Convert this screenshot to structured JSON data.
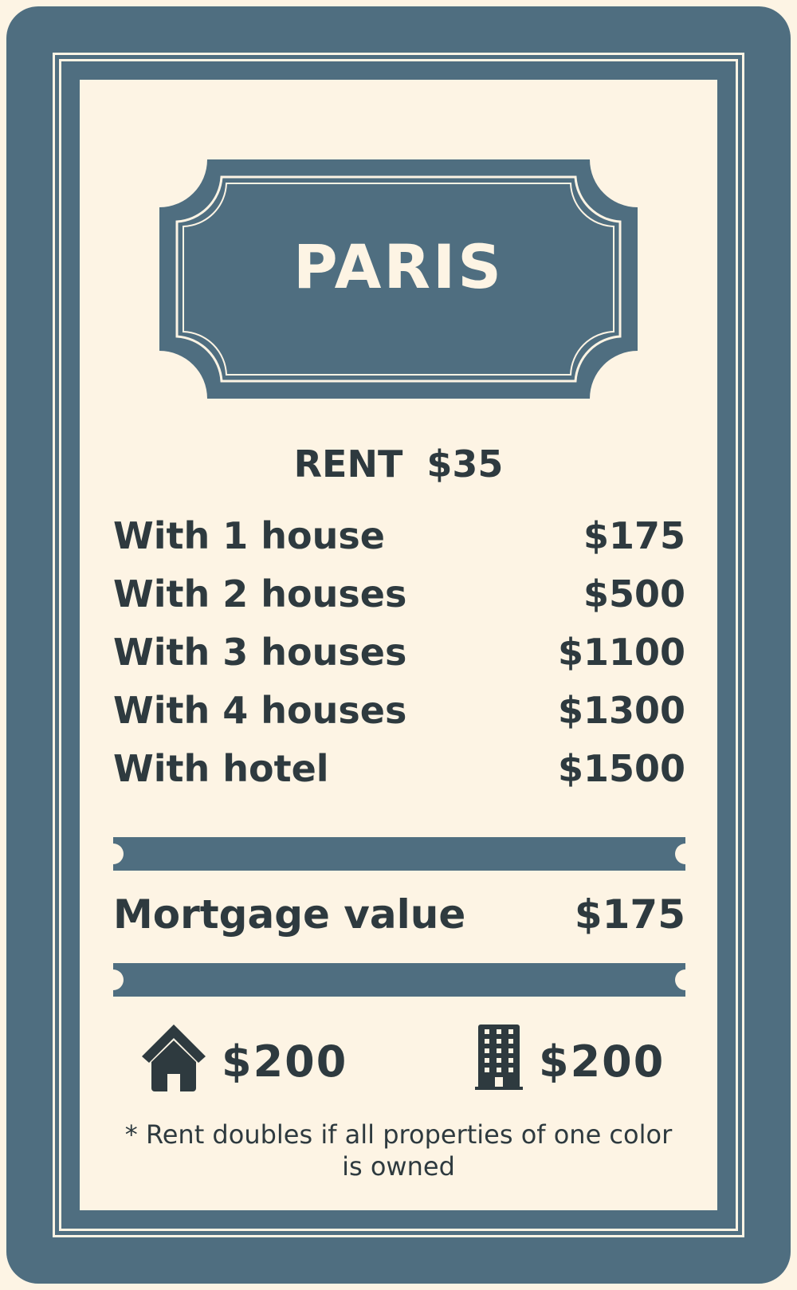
{
  "card": {
    "title": "PARIS",
    "rent_label": "RENT",
    "rent_value": "$35",
    "rent_rows": [
      {
        "label": "With 1 house",
        "value": "$175"
      },
      {
        "label": "With 2 houses",
        "value": "$500"
      },
      {
        "label": "With 3 houses",
        "value": "$1100"
      },
      {
        "label": "With 4 houses",
        "value": "$1300"
      },
      {
        "label": "With hotel",
        "value": "$1500"
      }
    ],
    "mortgage_label": "Mortgage value",
    "mortgage_value": "$175",
    "house_cost": "$200",
    "hotel_cost": "$200",
    "house_icon": "house-icon",
    "hotel_icon": "building-icon",
    "note": "* Rent doubles if all properties of one color is owned"
  },
  "colors": {
    "frame": "#4f6e80",
    "paper": "#fdf4e4",
    "text": "#2e3a3f"
  }
}
